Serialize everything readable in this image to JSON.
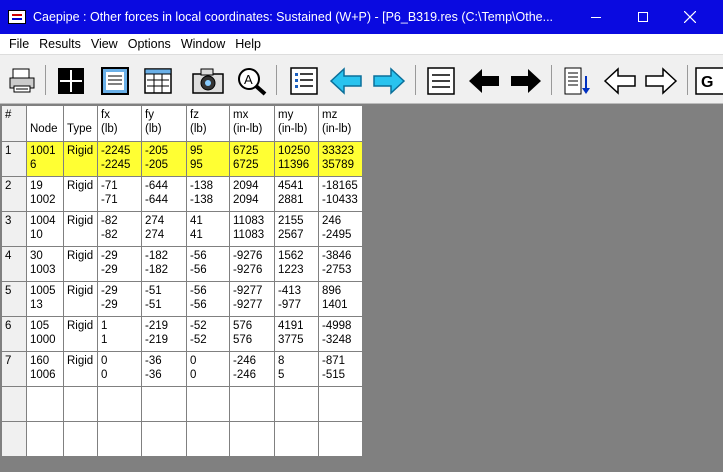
{
  "window": {
    "title": "Caepipe : Other forces in local coordinates: Sustained (W+P) -  [P6_B319.res (C:\\Temp\\Othe..."
  },
  "menu": [
    {
      "label": "File"
    },
    {
      "label": "Results"
    },
    {
      "label": "View"
    },
    {
      "label": "Options"
    },
    {
      "label": "Window"
    },
    {
      "label": "Help"
    }
  ],
  "toolbar": {
    "icons": [
      "print-icon",
      "grid-view-icon",
      "document-view-icon",
      "table-view-icon",
      "camera-icon",
      "zoom-icon",
      "list-icon",
      "arrow-left-cyan-icon",
      "arrow-right-cyan-icon",
      "lines-icon",
      "arrow-left-black-icon",
      "arrow-right-black-icon",
      "sort-down-icon",
      "arrow-left-outline-icon",
      "arrow-right-outline-icon",
      "goto-icon"
    ],
    "goto_label": "G"
  },
  "colors": {
    "titlebar": "#0a0ae0",
    "selected_row": "#ffff33",
    "cyan_arrow": "#29c3ef"
  },
  "table": {
    "headers": {
      "num": "#",
      "node": "Node",
      "type": "Type",
      "fx": "fx",
      "fx_unit": "(lb)",
      "fy": "fy",
      "fy_unit": "(lb)",
      "fz": "fz",
      "fz_unit": "(lb)",
      "mx": "mx",
      "mx_unit": "(in-lb)",
      "my": "my",
      "my_unit": "(in-lb)",
      "mz": "mz",
      "mz_unit": "(in-lb)"
    },
    "rows": [
      {
        "num": "1",
        "node1": "1001",
        "node2": "6",
        "type": "Rigid",
        "fx1": "-2245",
        "fx2": "-2245",
        "fy1": "-205",
        "fy2": "-205",
        "fz1": "95",
        "fz2": "95",
        "mx1": "6725",
        "mx2": "6725",
        "my1": "10250",
        "my2": "11396",
        "mz1": "33323",
        "mz2": "35789"
      },
      {
        "num": "2",
        "node1": "19",
        "node2": "1002",
        "type": "Rigid",
        "fx1": "-71",
        "fx2": "-71",
        "fy1": "-644",
        "fy2": "-644",
        "fz1": "-138",
        "fz2": "-138",
        "mx1": "2094",
        "mx2": "2094",
        "my1": "4541",
        "my2": "2881",
        "mz1": "-18165",
        "mz2": "-10433"
      },
      {
        "num": "3",
        "node1": "1004",
        "node2": "10",
        "type": "Rigid",
        "fx1": "-82",
        "fx2": "-82",
        "fy1": "274",
        "fy2": "274",
        "fz1": "41",
        "fz2": "41",
        "mx1": "11083",
        "mx2": "11083",
        "my1": "2155",
        "my2": "2567",
        "mz1": "246",
        "mz2": "-2495"
      },
      {
        "num": "4",
        "node1": "30",
        "node2": "1003",
        "type": "Rigid",
        "fx1": "-29",
        "fx2": "-29",
        "fy1": "-182",
        "fy2": "-182",
        "fz1": "-56",
        "fz2": "-56",
        "mx1": "-9276",
        "mx2": "-9276",
        "my1": "1562",
        "my2": "1223",
        "mz1": "-3846",
        "mz2": "-2753"
      },
      {
        "num": "5",
        "node1": "1005",
        "node2": "13",
        "type": "Rigid",
        "fx1": "-29",
        "fx2": "-29",
        "fy1": "-51",
        "fy2": "-51",
        "fz1": "-56",
        "fz2": "-56",
        "mx1": "-9277",
        "mx2": "-9277",
        "my1": "-413",
        "my2": "-977",
        "mz1": "896",
        "mz2": "1401"
      },
      {
        "num": "6",
        "node1": "105",
        "node2": "1000",
        "type": "Rigid",
        "fx1": "1",
        "fx2": "1",
        "fy1": "-219",
        "fy2": "-219",
        "fz1": "-52",
        "fz2": "-52",
        "mx1": "576",
        "mx2": "576",
        "my1": "4191",
        "my2": "3775",
        "mz1": "-4998",
        "mz2": "-3248"
      },
      {
        "num": "7",
        "node1": "160",
        "node2": "1006",
        "type": "Rigid",
        "fx1": "0",
        "fx2": "0",
        "fy1": "-36",
        "fy2": "-36",
        "fz1": "0",
        "fz2": "0",
        "mx1": "-246",
        "mx2": "-246",
        "my1": "8",
        "my2": "5",
        "mz1": "-871",
        "mz2": "-515"
      }
    ]
  }
}
